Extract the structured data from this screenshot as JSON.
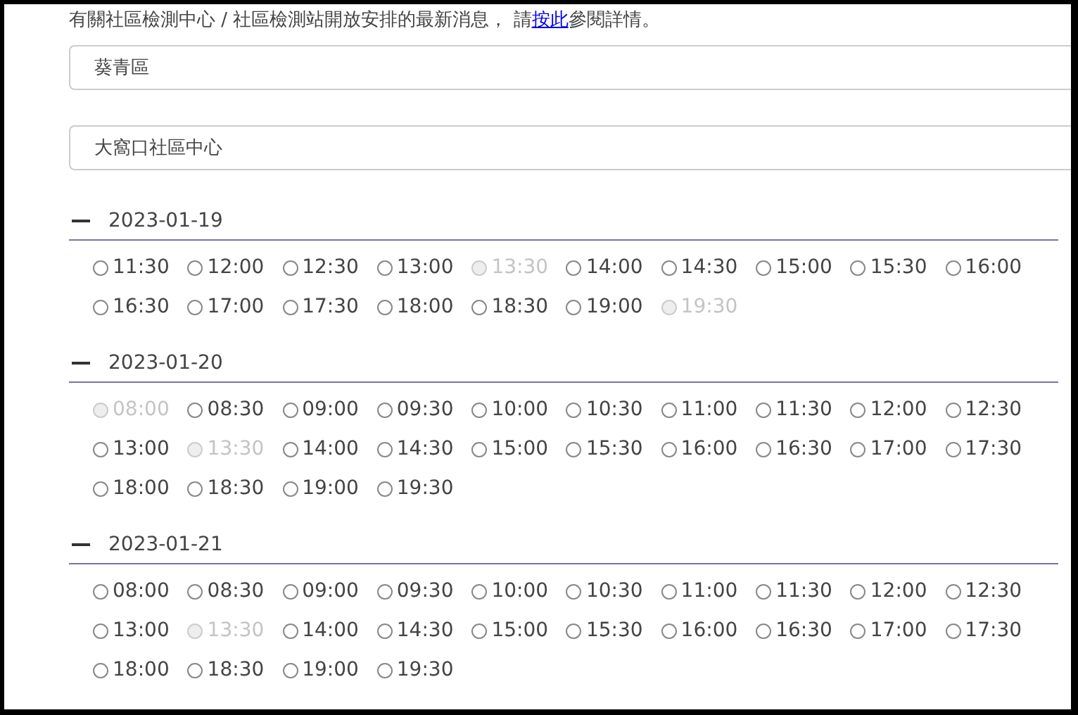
{
  "notice": {
    "before": "有關社區檢測中心 / 社區檢測站開放安排的最新消息， 請",
    "link": "按此",
    "after": "參閱詳情。"
  },
  "fields": [
    {
      "value": "葵青區"
    },
    {
      "value": "大窩口社區中心"
    }
  ],
  "sections": [
    {
      "date": "2023-01-19",
      "expanded": true,
      "slots": [
        {
          "time": "11:30",
          "disabled": false
        },
        {
          "time": "12:00",
          "disabled": false
        },
        {
          "time": "12:30",
          "disabled": false
        },
        {
          "time": "13:00",
          "disabled": false
        },
        {
          "time": "13:30",
          "disabled": true
        },
        {
          "time": "14:00",
          "disabled": false
        },
        {
          "time": "14:30",
          "disabled": false
        },
        {
          "time": "15:00",
          "disabled": false
        },
        {
          "time": "15:30",
          "disabled": false
        },
        {
          "time": "16:00",
          "disabled": false
        },
        {
          "time": "16:30",
          "disabled": false
        },
        {
          "time": "17:00",
          "disabled": false
        },
        {
          "time": "17:30",
          "disabled": false
        },
        {
          "time": "18:00",
          "disabled": false
        },
        {
          "time": "18:30",
          "disabled": false
        },
        {
          "time": "19:00",
          "disabled": false
        },
        {
          "time": "19:30",
          "disabled": true
        }
      ]
    },
    {
      "date": "2023-01-20",
      "expanded": true,
      "slots": [
        {
          "time": "08:00",
          "disabled": true
        },
        {
          "time": "08:30",
          "disabled": false
        },
        {
          "time": "09:00",
          "disabled": false
        },
        {
          "time": "09:30",
          "disabled": false
        },
        {
          "time": "10:00",
          "disabled": false
        },
        {
          "time": "10:30",
          "disabled": false
        },
        {
          "time": "11:00",
          "disabled": false
        },
        {
          "time": "11:30",
          "disabled": false
        },
        {
          "time": "12:00",
          "disabled": false
        },
        {
          "time": "12:30",
          "disabled": false
        },
        {
          "time": "13:00",
          "disabled": false
        },
        {
          "time": "13:30",
          "disabled": true
        },
        {
          "time": "14:00",
          "disabled": false
        },
        {
          "time": "14:30",
          "disabled": false
        },
        {
          "time": "15:00",
          "disabled": false
        },
        {
          "time": "15:30",
          "disabled": false
        },
        {
          "time": "16:00",
          "disabled": false
        },
        {
          "time": "16:30",
          "disabled": false
        },
        {
          "time": "17:00",
          "disabled": false
        },
        {
          "time": "17:30",
          "disabled": false
        },
        {
          "time": "18:00",
          "disabled": false
        },
        {
          "time": "18:30",
          "disabled": false
        },
        {
          "time": "19:00",
          "disabled": false
        },
        {
          "time": "19:30",
          "disabled": false
        }
      ]
    },
    {
      "date": "2023-01-21",
      "expanded": true,
      "slots": [
        {
          "time": "08:00",
          "disabled": false
        },
        {
          "time": "08:30",
          "disabled": false
        },
        {
          "time": "09:00",
          "disabled": false
        },
        {
          "time": "09:30",
          "disabled": false
        },
        {
          "time": "10:00",
          "disabled": false
        },
        {
          "time": "10:30",
          "disabled": false
        },
        {
          "time": "11:00",
          "disabled": false
        },
        {
          "time": "11:30",
          "disabled": false
        },
        {
          "time": "12:00",
          "disabled": false
        },
        {
          "time": "12:30",
          "disabled": false
        },
        {
          "time": "13:00",
          "disabled": false
        },
        {
          "time": "13:30",
          "disabled": true
        },
        {
          "time": "14:00",
          "disabled": false
        },
        {
          "time": "14:30",
          "disabled": false
        },
        {
          "time": "15:00",
          "disabled": false
        },
        {
          "time": "15:30",
          "disabled": false
        },
        {
          "time": "16:00",
          "disabled": false
        },
        {
          "time": "16:30",
          "disabled": false
        },
        {
          "time": "17:00",
          "disabled": false
        },
        {
          "time": "17:30",
          "disabled": false
        },
        {
          "time": "18:00",
          "disabled": false
        },
        {
          "time": "18:30",
          "disabled": false
        },
        {
          "time": "19:00",
          "disabled": false
        },
        {
          "time": "19:30",
          "disabled": false
        }
      ]
    }
  ]
}
